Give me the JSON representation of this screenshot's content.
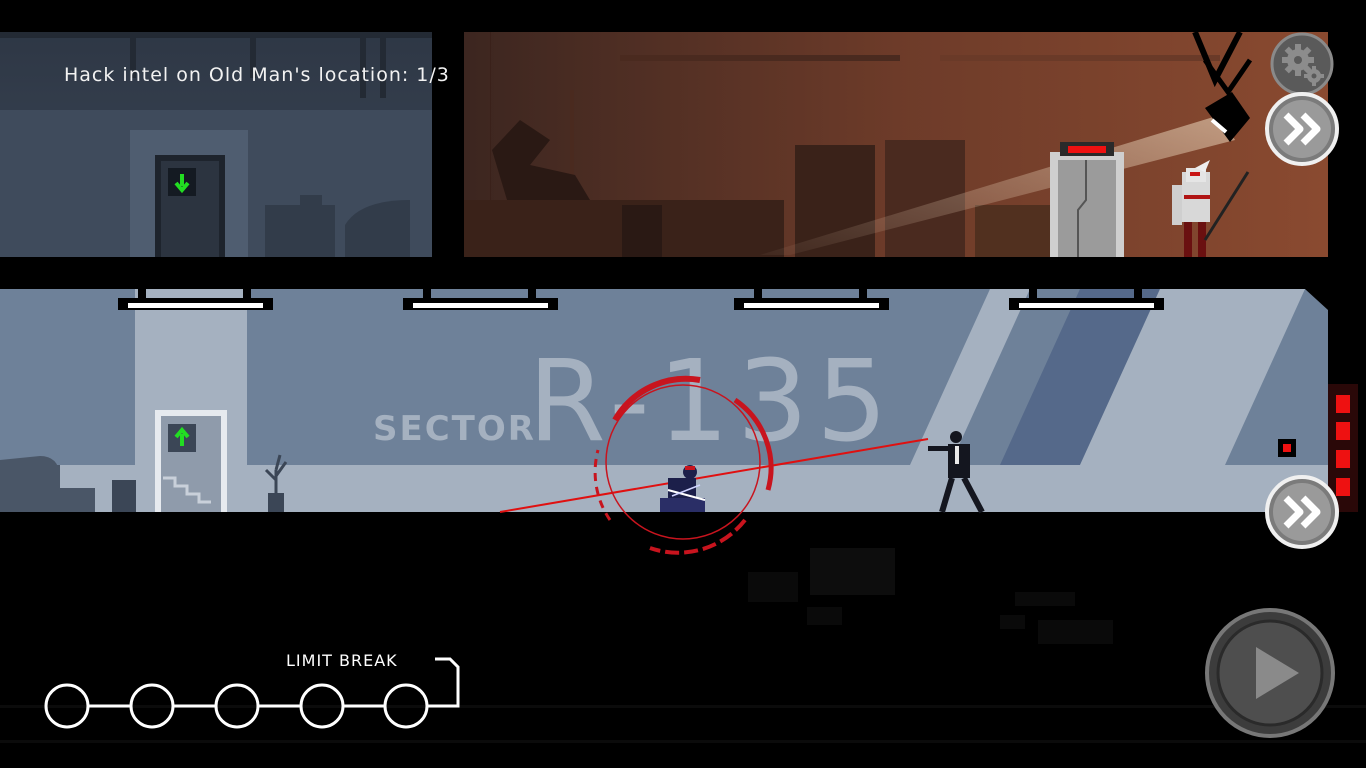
{
  "hud": {
    "objective": "Hack intel on Old Man's location: 1/3",
    "limit_break_label": "LIMIT BREAK",
    "limit_break_nodes": 5,
    "limit_break_filled": 0
  },
  "world": {
    "sector_word": "SECTOR",
    "sector_code": "R-135"
  },
  "icons": {
    "settings": "gear-icon",
    "fast_forward": "fast-forward-icon",
    "play": "play-icon",
    "elevator_down": "arrow-down-icon",
    "elevator_up": "arrow-up-icon"
  },
  "colors": {
    "upper_left_room": "#35404f",
    "upper_right_room": "#6b3a2a",
    "lower_room": "#6e8199",
    "laser": "#e01010",
    "target_reticle": "#c8141e",
    "elevator_arrow": "#22dd22",
    "alarm_red": "#ee1111"
  }
}
